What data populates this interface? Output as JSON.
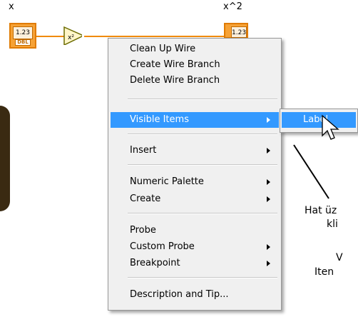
{
  "diagram": {
    "input_label": "x",
    "output_label": "x^2",
    "input_value": "1.23",
    "input_type": "DBL",
    "output_value": "1.23",
    "square_function": "x²"
  },
  "context_menu": {
    "items": [
      {
        "label": "Clean Up Wire",
        "has_submenu": false
      },
      {
        "label": "Create Wire Branch",
        "has_submenu": false
      },
      {
        "label": "Delete Wire Branch",
        "has_submenu": false
      },
      {
        "label": "Visible Items",
        "has_submenu": true,
        "highlighted": true
      },
      {
        "label": "Insert",
        "has_submenu": true
      },
      {
        "label": "Numeric Palette",
        "has_submenu": true
      },
      {
        "label": "Create",
        "has_submenu": true
      },
      {
        "label": "Probe",
        "has_submenu": false
      },
      {
        "label": "Custom Probe",
        "has_submenu": true
      },
      {
        "label": "Breakpoint",
        "has_submenu": true
      },
      {
        "label": "Description and Tip...",
        "has_submenu": false
      }
    ]
  },
  "submenu": {
    "items": [
      {
        "label": "Label",
        "highlighted": true
      }
    ]
  },
  "annotation": {
    "line1": "Hat üz",
    "line2": "kli",
    "line3": "V",
    "line4": "Iten"
  },
  "colors": {
    "wire": "#f08a00",
    "terminal": "#f6a236",
    "highlight": "#3399ff"
  }
}
